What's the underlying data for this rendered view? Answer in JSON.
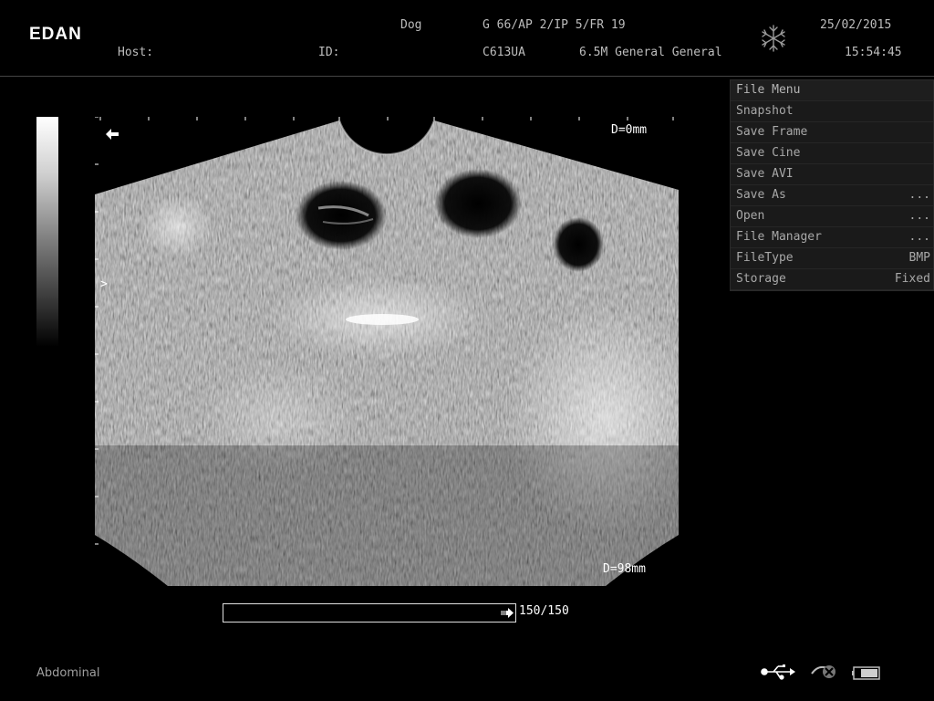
{
  "header": {
    "logo": "EDAN",
    "patient_type": "Dog",
    "host_label": "Host:",
    "id_label": "ID:",
    "params": "G 66/AP 2/IP 5/FR 19",
    "probe": "C613UA",
    "preset": "6.5M General General",
    "date": "25/02/2015",
    "time": "15:54:45",
    "freeze_icon": "snowflake-icon"
  },
  "image": {
    "depth_top": "D=0mm",
    "depth_bottom": "D=98mm",
    "focus_marker": ">",
    "direction_icon": "arrow-left-icon"
  },
  "menu": {
    "title": "File Menu",
    "items": [
      {
        "label": "Snapshot",
        "value": ""
      },
      {
        "label": "Save Frame",
        "value": ""
      },
      {
        "label": "Save Cine",
        "value": ""
      },
      {
        "label": "Save AVI",
        "value": ""
      },
      {
        "label": "Save As",
        "value": "..."
      },
      {
        "label": "Open",
        "value": "..."
      },
      {
        "label": "File Manager",
        "value": "..."
      },
      {
        "label": "FileType",
        "value": "BMP"
      },
      {
        "label": "Storage",
        "value": "Fixed"
      }
    ]
  },
  "cine": {
    "count": "150/150",
    "position_fraction": 1.0
  },
  "footer": {
    "exam": "Abdominal",
    "icons": [
      "usb-icon",
      "network-icon",
      "battery-icon"
    ]
  }
}
